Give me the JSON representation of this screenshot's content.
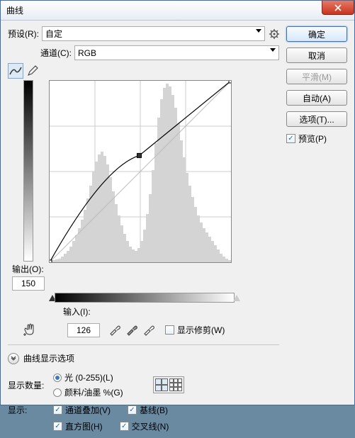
{
  "window_title": "曲线",
  "preset_label": "预设(R):",
  "preset_value": "自定",
  "channel_label": "通道(C):",
  "channel_value": "RGB",
  "output_label": "输出(O):",
  "output_value": "150",
  "input_label": "输入(I):",
  "input_value": "126",
  "show_clip_label": "显示修剪(W)",
  "expand_label": "曲线显示选项",
  "amount_label": "显示数量:",
  "radio_light": "光 (0-255)(L)",
  "radio_pigment": "颜料/油墨 %(G)",
  "show_label": "显示:",
  "chk_overlay": "通道叠加(V)",
  "chk_baseline": "基线(B)",
  "chk_histogram": "直方图(H)",
  "chk_cross": "交叉线(N)",
  "btn_ok": "确定",
  "btn_cancel": "取消",
  "btn_smooth": "平滑(M)",
  "btn_auto": "自动(A)",
  "btn_options": "选项(T)...",
  "preview_label": "预览(P)",
  "chart_data": {
    "type": "curve",
    "x_range": [
      0,
      255
    ],
    "y_range": [
      0,
      255
    ],
    "points": [
      {
        "x": 0,
        "y": 0
      },
      {
        "x": 126,
        "y": 150
      },
      {
        "x": 255,
        "y": 255
      }
    ],
    "histogram": [
      2,
      3,
      4,
      5,
      8,
      12,
      16,
      22,
      30,
      38,
      48,
      60,
      74,
      90,
      108,
      128,
      142,
      152,
      156,
      150,
      138,
      120,
      100,
      82,
      66,
      52,
      40,
      30,
      22,
      18,
      16,
      20,
      30,
      46,
      68,
      96,
      130,
      168,
      204,
      230,
      246,
      252,
      248,
      236,
      218,
      196,
      172,
      148,
      126,
      108,
      92,
      78,
      66,
      56,
      48,
      42,
      36,
      30,
      24,
      18,
      12,
      8,
      5,
      3
    ]
  }
}
